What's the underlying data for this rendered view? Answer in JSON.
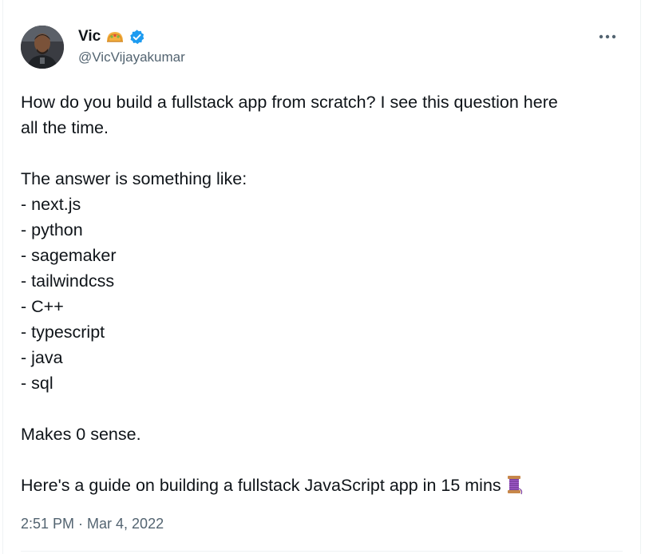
{
  "author": {
    "display_name": "Vic",
    "handle": "@VicVijayakumar",
    "name_emoji": "taco-emoji",
    "verified_icon": "verified-badge-icon",
    "avatar": "profile-photo"
  },
  "menu_icon": "more-options-icon",
  "tweet": {
    "paragraph1": [
      "How do you build a fullstack app from scratch? I see this question here",
      "all the time."
    ],
    "intro": "The answer is something like:",
    "list": [
      "- next.js",
      "- python",
      "- sagemaker",
      "- tailwindcss",
      "- C++",
      "- typescript",
      "- java",
      "- sql"
    ],
    "conclusion": "Makes 0 sense.",
    "guide": "Here's a guide on building a fullstack JavaScript app in 15 mins",
    "guide_emoji": "thread-spool-emoji"
  },
  "meta": {
    "timestamp": "2:51 PM · Mar 4, 2022"
  },
  "colors": {
    "text_primary": "#0f1419",
    "text_secondary": "#536471",
    "verified_blue": "#1d9bf0",
    "divider": "#eff3f4"
  }
}
